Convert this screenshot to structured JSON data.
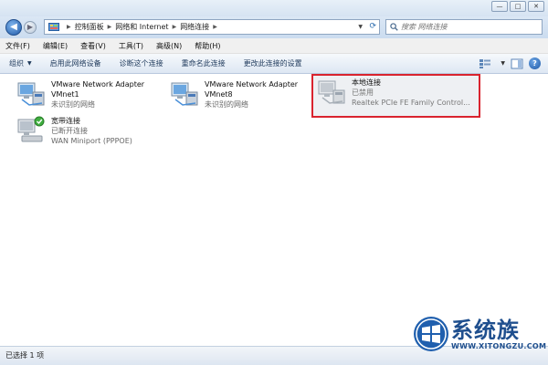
{
  "window": {
    "minimize": "—",
    "maximize": "□",
    "close": "✕"
  },
  "address": {
    "crumbs": [
      "控制面板",
      "网络和 Internet",
      "网络连接"
    ],
    "search_placeholder": "搜索 网络连接"
  },
  "menu": [
    "文件(F)",
    "编辑(E)",
    "查看(V)",
    "工具(T)",
    "高级(N)",
    "帮助(H)"
  ],
  "commands": {
    "organize": "组织",
    "enable": "启用此网络设备",
    "diagnose": "诊断这个连接",
    "rename": "重命名此连接",
    "change_settings": "更改此连接的设置"
  },
  "connections": [
    {
      "name": "VMware Network Adapter VMnet1",
      "status": "未识别的网络",
      "icon": "network-adapter-icon"
    },
    {
      "name": "VMware Network Adapter VMnet8",
      "status": "未识别的网络",
      "icon": "network-adapter-icon"
    },
    {
      "name": "本地连接",
      "status": "已禁用",
      "device": "Realtek PCIe FE Family Control...",
      "icon": "network-adapter-disabled-icon",
      "selected": true
    },
    {
      "name": "宽带连接",
      "status": "已断开连接",
      "device": "WAN Miniport (PPPOE)",
      "icon": "broadband-connection-icon"
    }
  ],
  "status_bar": "已选择 1 项",
  "watermark": {
    "name": "系统族",
    "url": "WWW.XITONGZU.COM"
  },
  "colors": {
    "selection_border": "#d9232e",
    "accent": "#1f4f8e"
  }
}
